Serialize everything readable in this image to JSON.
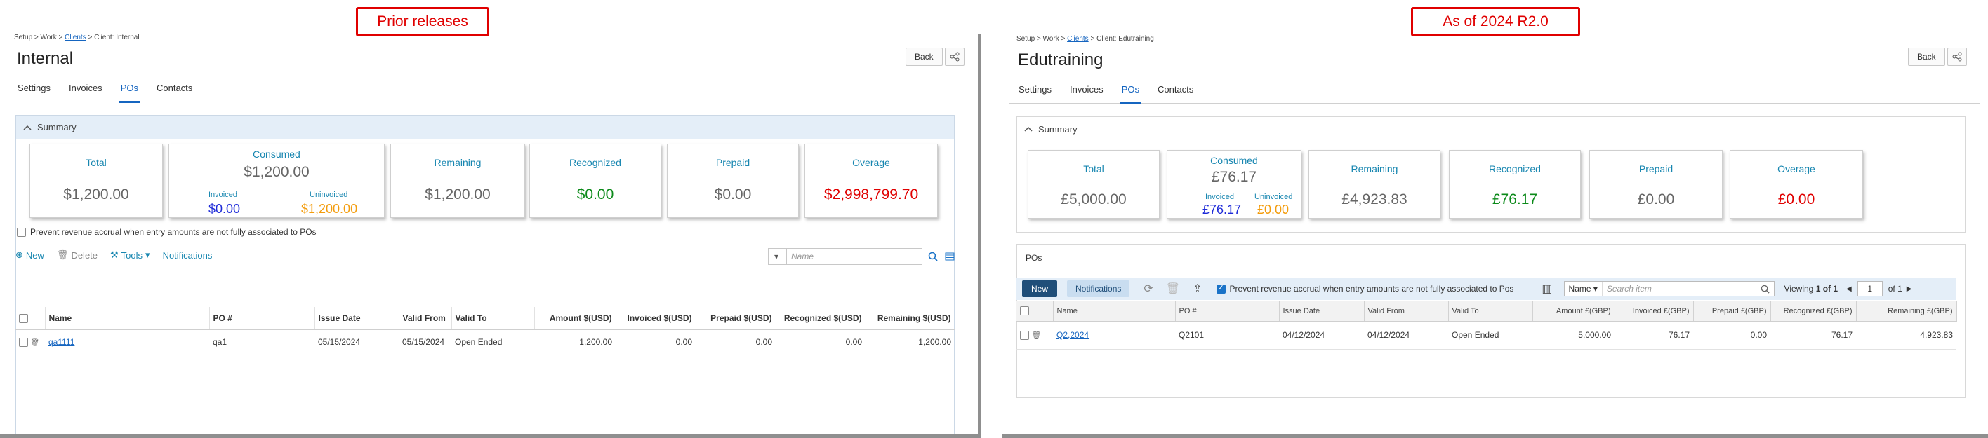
{
  "banners": {
    "left": "Prior releases",
    "right": "As of 2024 R2.0"
  },
  "left": {
    "breadcrumb": {
      "p1": "Setup",
      "p2": "Work",
      "p3": "Clients",
      "p4": "Client: Internal"
    },
    "title": "Internal",
    "back_label": "Back",
    "tabs": [
      "Settings",
      "Invoices",
      "POs",
      "Contacts"
    ],
    "summary_label": "Summary",
    "cards": {
      "total_label": "Total",
      "total_value": "$1,200.00",
      "consumed_label": "Consumed",
      "consumed_value": "$1,200.00",
      "invoiced_label": "Invoiced",
      "invoiced_value": "$0.00",
      "uninvoiced_label": "Uninvoiced",
      "uninvoiced_value": "$1,200.00",
      "remaining_label": "Remaining",
      "remaining_value": "$1,200.00",
      "recognized_label": "Recognized",
      "recognized_value": "$0.00",
      "prepaid_label": "Prepaid",
      "prepaid_value": "$0.00",
      "overage_label": "Overage",
      "overage_value": "$2,998,799.70"
    },
    "prevent_label": "Prevent revenue accrual when entry amounts are not fully associated to POs",
    "toolbar": {
      "new": "New",
      "delete": "Delete",
      "tools": "Tools",
      "notifications": "Notifications"
    },
    "search_placeholder": "Name",
    "columns": [
      "Name",
      "PO #",
      "Issue Date",
      "Valid From",
      "Valid To",
      "Amount $(USD)",
      "Invoiced $(USD)",
      "Prepaid $(USD)",
      "Recognized $(USD)",
      "Remaining $(USD)"
    ],
    "row": [
      "qa1111",
      "qa1",
      "05/15/2024",
      "05/15/2024",
      "Open Ended",
      "1,200.00",
      "0.00",
      "0.00",
      "0.00",
      "1,200.00"
    ]
  },
  "right": {
    "breadcrumb": {
      "p1": "Setup",
      "p2": "Work",
      "p3": "Clients",
      "p4": "Client: Edutraining"
    },
    "title": "Edutraining",
    "back_label": "Back",
    "tabs": [
      "Settings",
      "Invoices",
      "POs",
      "Contacts"
    ],
    "summary_label": "Summary",
    "cards": {
      "total_label": "Total",
      "total_value": "£5,000.00",
      "consumed_label": "Consumed",
      "consumed_value": "£76.17",
      "invoiced_label": "Invoiced",
      "invoiced_value": "£76.17",
      "uninvoiced_label": "Uninvoiced",
      "uninvoiced_value": "£0.00",
      "remaining_label": "Remaining",
      "remaining_value": "£4,923.83",
      "recognized_label": "Recognized",
      "recognized_value": "£76.17",
      "prepaid_label": "Prepaid",
      "prepaid_value": "£0.00",
      "overage_label": "Overage",
      "overage_value": "£0.00"
    },
    "pos_label": "POs",
    "toolbar": {
      "new": "New",
      "notifications": "Notifications"
    },
    "prevent_label": "Prevent revenue accrual when entry amounts are not fully associated to Pos",
    "name_select": "Name",
    "search_placeholder": "Search item",
    "pager": {
      "viewing": "Viewing",
      "range": "1 of 1",
      "page": "1",
      "of": "of 1"
    },
    "columns": [
      "Name",
      "PO #",
      "Issue Date",
      "Valid From",
      "Valid To",
      "Amount £(GBP)",
      "Invoiced £(GBP)",
      "Prepaid £(GBP)",
      "Recognized £(GBP)",
      "Remaining £(GBP)"
    ],
    "row": [
      "Q2,2024",
      "Q2101",
      "04/12/2024",
      "04/12/2024",
      "Open Ended",
      "5,000.00",
      "76.17",
      "0.00",
      "76.17",
      "4,923.83"
    ]
  },
  "colors": {
    "accent": "#1565c0",
    "green": "#0c8a1a",
    "red": "#e00000",
    "orange": "#f39c0c",
    "banner": "#e00000"
  }
}
